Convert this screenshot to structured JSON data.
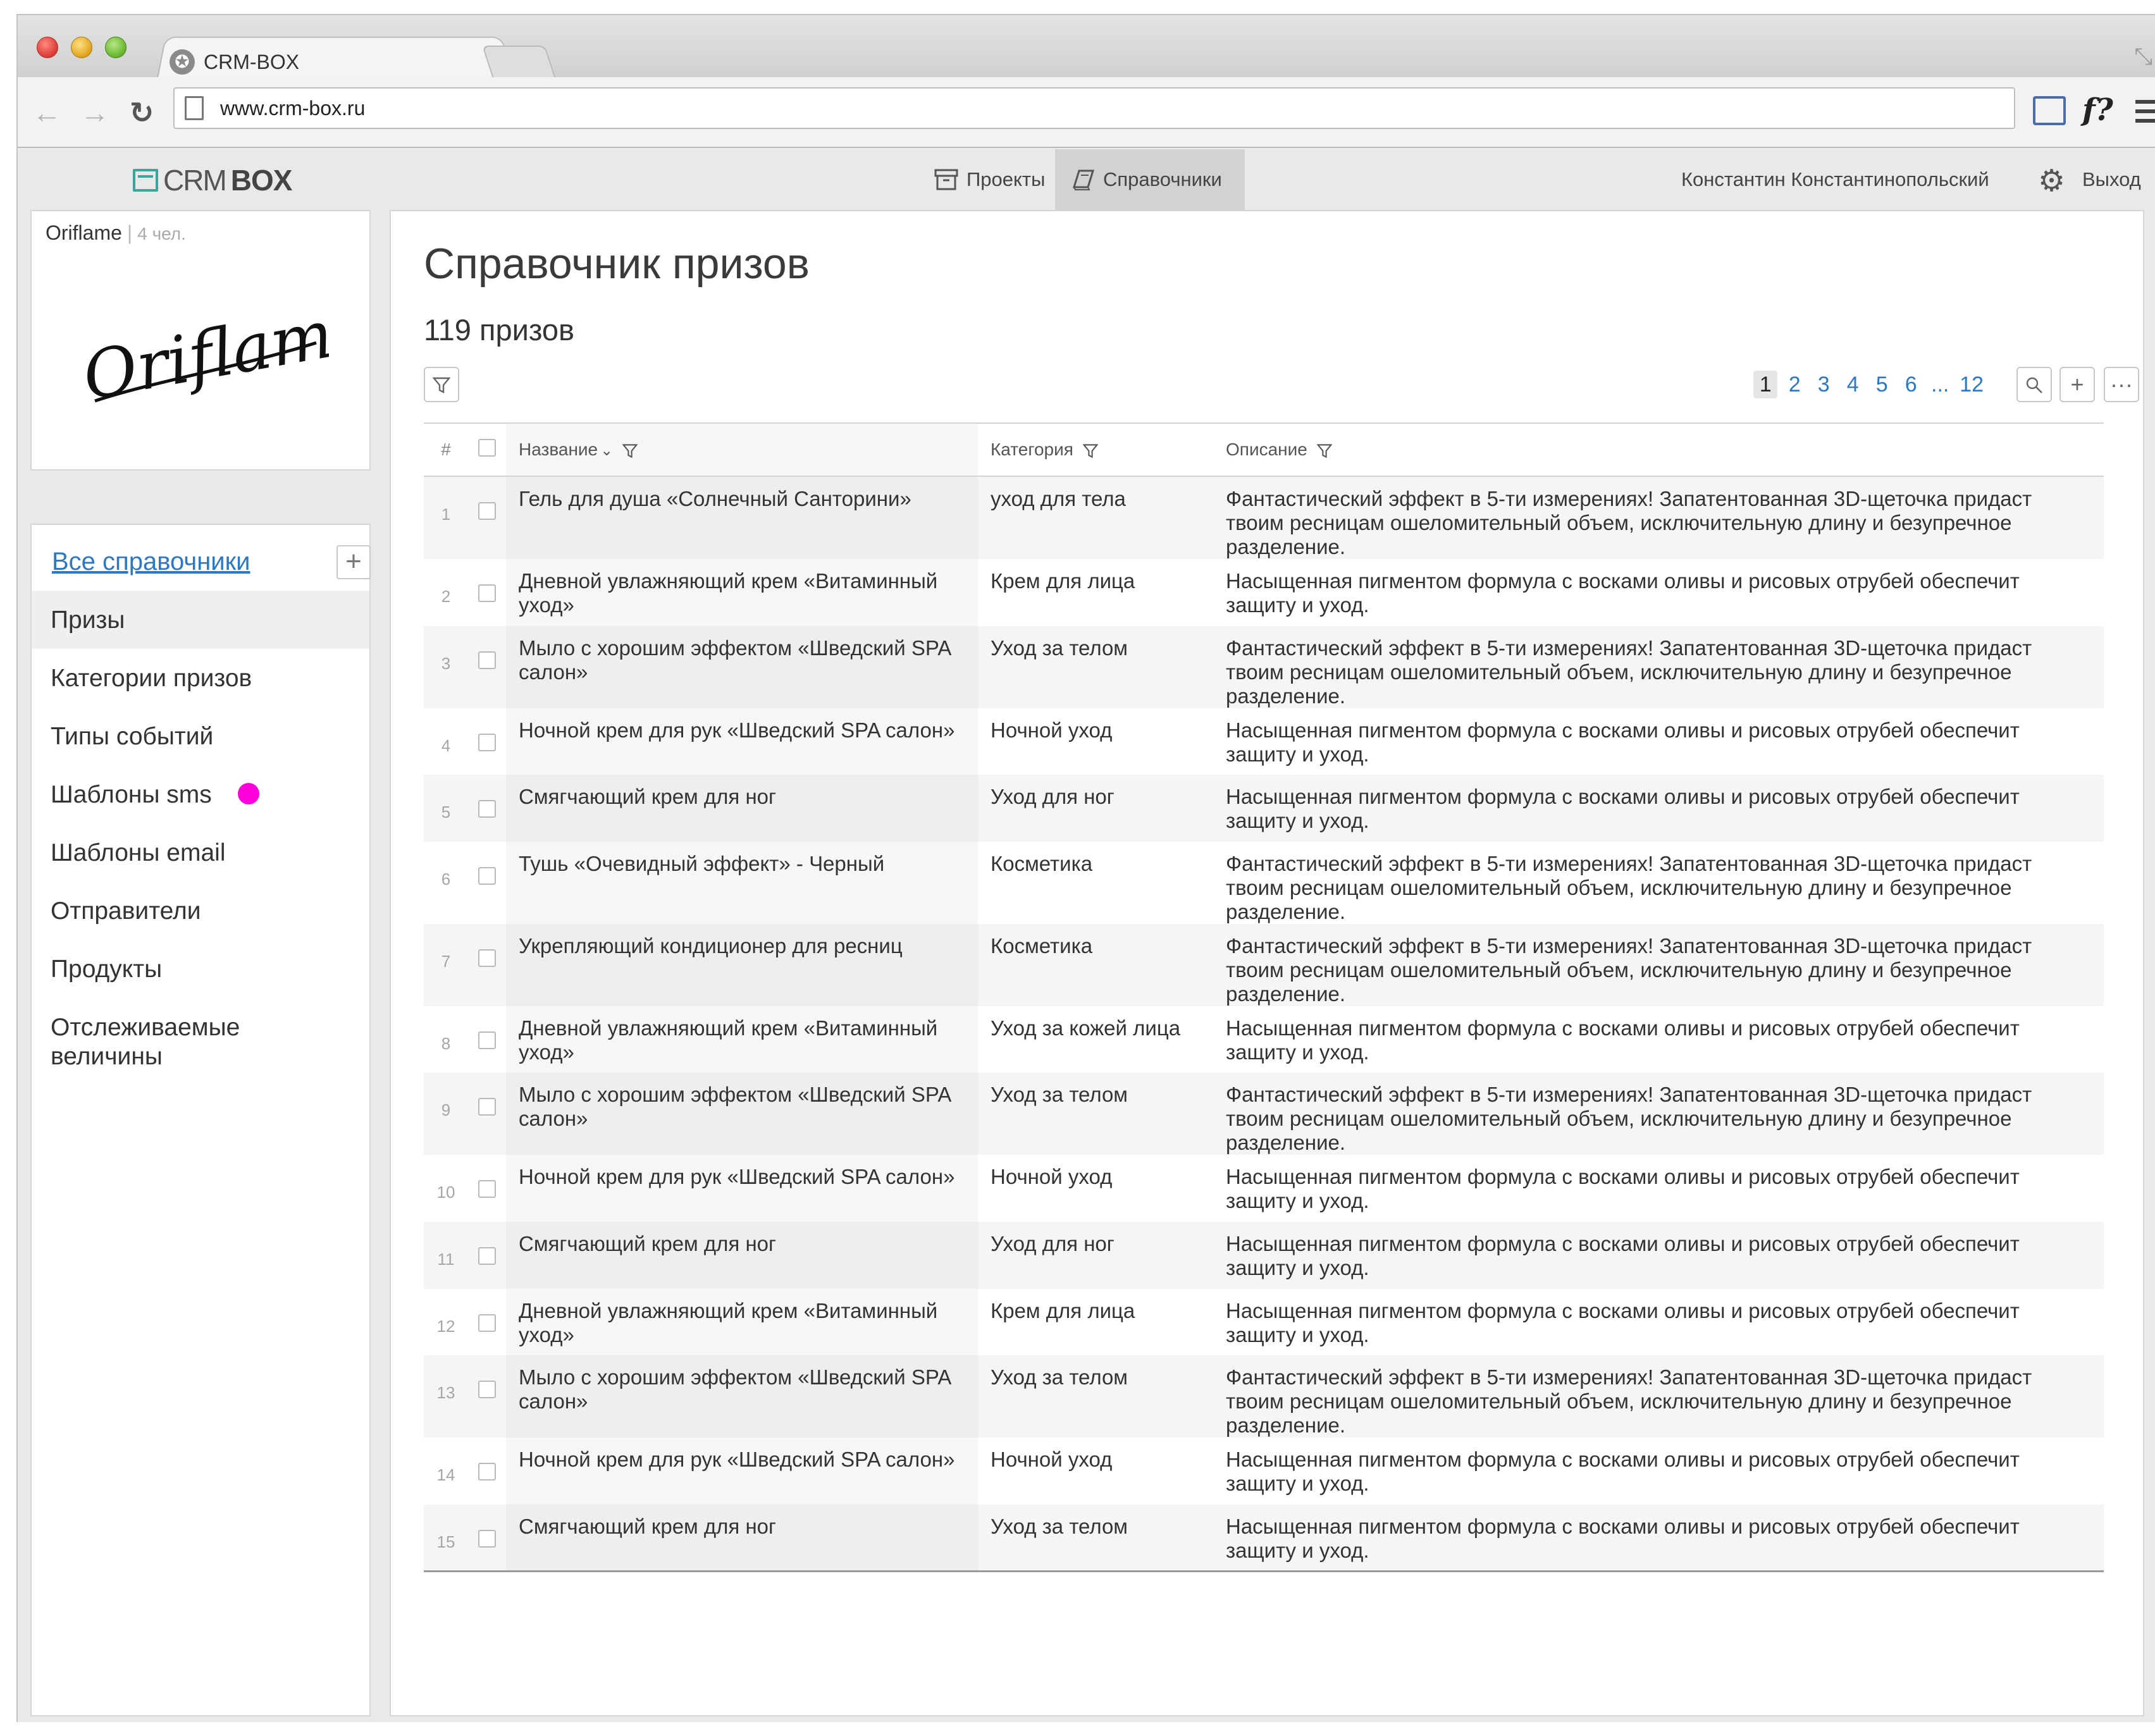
{
  "browser": {
    "tab_title": "CRM-BOX",
    "url": "www.crm-box.ru",
    "ext_label": "f?"
  },
  "app": {
    "logo_part1": "CRM",
    "logo_part2": "BOX",
    "nav": [
      {
        "label": "Проекты",
        "active": false
      },
      {
        "label": "Справочники",
        "active": true
      }
    ],
    "user_name": "Константин Константинопольский",
    "logout_label": "Выход"
  },
  "org": {
    "name": "Oriflame",
    "separator": "|",
    "member_count": "4 чел.",
    "logo_text": "Oriflame"
  },
  "sidebar": {
    "all_refs_label": "Все справочники",
    "add_label": "+",
    "items": [
      {
        "label": "Призы",
        "active": true
      },
      {
        "label": "Категории призов",
        "active": false
      },
      {
        "label": "Типы событий",
        "active": false
      },
      {
        "label": "Шаблоны sms",
        "active": false,
        "badge_color": "#ff00dd"
      },
      {
        "label": "Шаблоны email",
        "active": false
      },
      {
        "label": "Отправители",
        "active": false
      },
      {
        "label": "Продукты",
        "active": false
      },
      {
        "label": "Отслеживаемые величины",
        "active": false
      }
    ]
  },
  "main": {
    "title": "Справочник призов",
    "count_label": "119 призов",
    "pager": [
      "1",
      "2",
      "3",
      "4",
      "5",
      "6",
      "...",
      "12"
    ],
    "current_page": "1",
    "add_label": "+",
    "more_label": "···",
    "columns": {
      "num": "#",
      "name": "Название",
      "category": "Категория",
      "description": "Описание"
    },
    "rows": [
      {
        "n": "1",
        "name": "Гель для душа «Солнечный Санторини»",
        "category": "уход для тела",
        "description": "Фантастический эффект в 5-ти измерениях! Запатентованная 3D-щеточка придаст твоим ресницам ошеломительный объем, исключительную длину и безупречное разделение."
      },
      {
        "n": "2",
        "name": "Дневной увлажняющий крем «Витаминный уход»",
        "category": "Крем для лица",
        "description": "Насыщенная пигментом формула с восками оливы и рисовых отрубей обеспечит защиту и уход."
      },
      {
        "n": "3",
        "name": "Мыло с хорошим эффектом «Шведский SPA салон»",
        "category": "Уход за телом",
        "description": "Фантастический эффект в 5-ти измерениях! Запатентованная 3D-щеточка придаст твоим ресницам ошеломительный объем, исключительную длину и безупречное разделение."
      },
      {
        "n": "4",
        "name": "Ночной крем для рук «Шведский SPA салон»",
        "category": "Ночной уход",
        "description": "Насыщенная пигментом формула с восками оливы и рисовых отрубей обеспечит защиту и уход."
      },
      {
        "n": "5",
        "name": "Смягчающий крем для ног",
        "category": "Уход для ног",
        "description": "Насыщенная пигментом формула с восками оливы и рисовых отрубей обеспечит защиту и уход."
      },
      {
        "n": "6",
        "name": "Тушь «Очевидный эффект» - Черный",
        "category": "Косметика",
        "description": "Фантастический эффект в 5-ти измерениях! Запатентованная 3D-щеточка придаст твоим ресницам ошеломительный объем, исключительную длину и безупречное разделение."
      },
      {
        "n": "7",
        "name": "Укрепляющий кондиционер для ресниц",
        "category": "Косметика",
        "description": "Фантастический эффект в 5-ти измерениях! Запатентованная 3D-щеточка придаст твоим ресницам ошеломительный объем, исключительную длину и безупречное разделение."
      },
      {
        "n": "8",
        "name": "Дневной увлажняющий крем «Витаминный уход»",
        "category": "Уход за кожей лица",
        "description": "Насыщенная пигментом формула с восками оливы и рисовых отрубей обеспечит защиту и уход."
      },
      {
        "n": "9",
        "name": "Мыло с хорошим эффектом «Шведский SPA салон»",
        "category": "Уход за телом",
        "description": "Фантастический эффект в 5-ти измерениях! Запатентованная 3D-щеточка придаст твоим ресницам ошеломительный объем, исключительную длину и безупречное разделение."
      },
      {
        "n": "10",
        "name": "Ночной крем для рук «Шведский SPA салон»",
        "category": "Ночной уход",
        "description": "Насыщенная пигментом формула с восками оливы и рисовых отрубей обеспечит защиту и уход."
      },
      {
        "n": "11",
        "name": "Смягчающий крем для ног",
        "category": "Уход для ног",
        "description": "Насыщенная пигментом формула с восками оливы и рисовых отрубей обеспечит защиту и уход."
      },
      {
        "n": "12",
        "name": "Дневной увлажняющий крем «Витаминный уход»",
        "category": "Крем для лица",
        "description": "Насыщенная пигментом формула с восками оливы и рисовых отрубей обеспечит защиту и уход."
      },
      {
        "n": "13",
        "name": "Мыло с хорошим эффектом «Шведский SPA салон»",
        "category": "Уход за телом",
        "description": "Фантастический эффект в 5-ти измерениях! Запатентованная 3D-щеточка придаст твоим ресницам ошеломительный объем, исключительную длину и безупречное разделение."
      },
      {
        "n": "14",
        "name": "Ночной крем для рук «Шведский SPA салон»",
        "category": "Ночной уход",
        "description": "Насыщенная пигментом формула с восками оливы и рисовых отрубей обеспечит защиту и уход."
      },
      {
        "n": "15",
        "name": "Смягчающий крем для ног",
        "category": "Уход за телом",
        "description": "Насыщенная пигментом формула с восками оливы и рисовых отрубей обеспечит защиту и уход."
      }
    ]
  },
  "colors": {
    "link": "#2a78c6",
    "logo_accent": "#3aa59b",
    "badge": "#ff00dd"
  }
}
